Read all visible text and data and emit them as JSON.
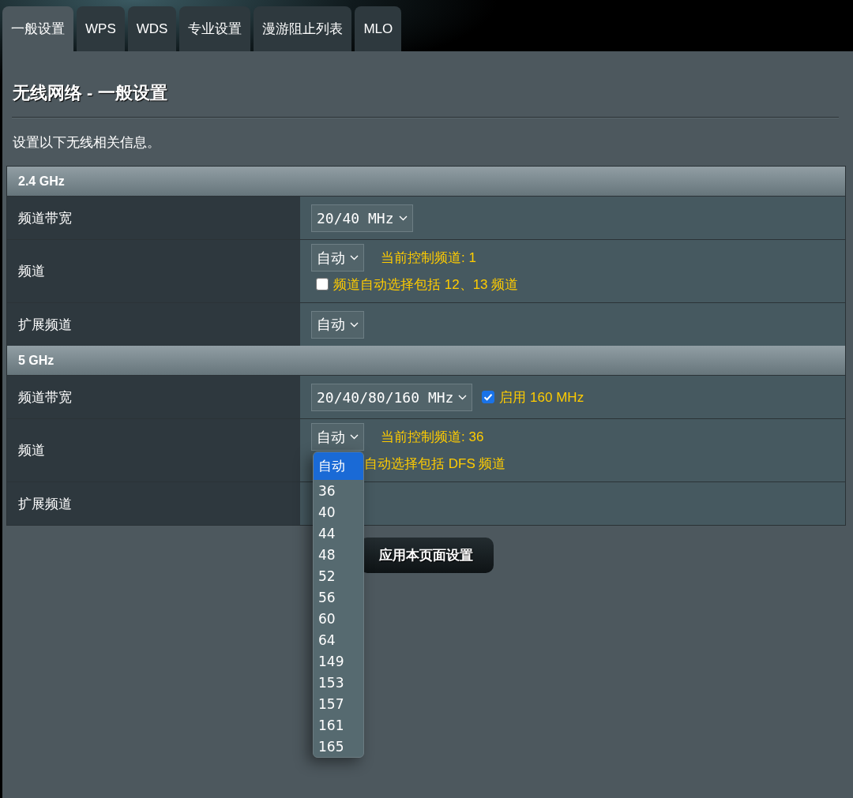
{
  "tabs": [
    {
      "label": "一般设置",
      "selected": true
    },
    {
      "label": "WPS",
      "selected": false
    },
    {
      "label": "WDS",
      "selected": false
    },
    {
      "label": "专业设置",
      "selected": false
    },
    {
      "label": "漫游阻止列表",
      "selected": false
    },
    {
      "label": "MLO",
      "selected": false
    }
  ],
  "heading": {
    "title": "无线网络 - 一般设置",
    "description": "设置以下无线相关信息。"
  },
  "bands": [
    {
      "name": "2.4 GHz",
      "rows": [
        {
          "label": "频道带宽",
          "lines": [
            [
              {
                "kind": "select",
                "value": "20/40 MHz"
              }
            ]
          ]
        },
        {
          "label": "频道",
          "lines": [
            [
              {
                "kind": "select",
                "value": "自动"
              },
              {
                "kind": "status",
                "text": "当前控制频道: 1"
              }
            ],
            [
              {
                "kind": "checkbox",
                "checked": false,
                "text": "频道自动选择包括 12、13 频道"
              }
            ]
          ]
        },
        {
          "label": "扩展频道",
          "lines": [
            [
              {
                "kind": "select",
                "value": "自动"
              }
            ]
          ]
        }
      ]
    },
    {
      "name": "5 GHz",
      "rows": [
        {
          "label": "频道带宽",
          "lines": [
            [
              {
                "kind": "select",
                "value": "20/40/80/160 MHz"
              },
              {
                "kind": "checkbox",
                "checked": true,
                "text": "启用 160 MHz"
              }
            ]
          ]
        },
        {
          "label": "频道",
          "lines": [
            [
              {
                "kind": "select",
                "value": "自动",
                "open": true,
                "options": [
                  {
                    "label": "自动",
                    "selected": true
                  },
                  {
                    "label": "36",
                    "selected": false
                  },
                  {
                    "label": "40",
                    "selected": false
                  },
                  {
                    "label": "44",
                    "selected": false
                  },
                  {
                    "label": "48",
                    "selected": false
                  },
                  {
                    "label": "52",
                    "selected": false
                  },
                  {
                    "label": "56",
                    "selected": false
                  },
                  {
                    "label": "60",
                    "selected": false
                  },
                  {
                    "label": "64",
                    "selected": false
                  },
                  {
                    "label": "149",
                    "selected": false
                  },
                  {
                    "label": "153",
                    "selected": false
                  },
                  {
                    "label": "157",
                    "selected": false
                  },
                  {
                    "label": "161",
                    "selected": false
                  },
                  {
                    "label": "165",
                    "selected": false
                  }
                ]
              },
              {
                "kind": "status",
                "text": "当前控制频道: 36"
              }
            ],
            [
              {
                "kind": "covered_text",
                "text": "自动选择包括 DFS 频道"
              }
            ]
          ]
        },
        {
          "label": "扩展频道"
        }
      ]
    }
  ],
  "apply_button": "应用本页面设置"
}
